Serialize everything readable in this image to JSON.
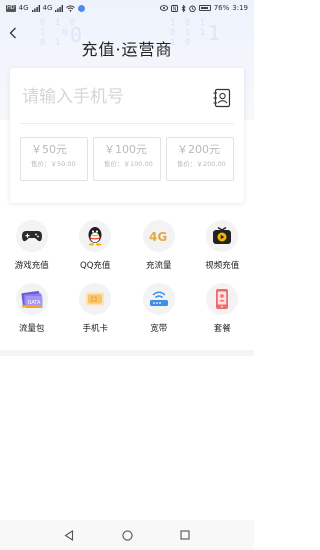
{
  "status_bar": {
    "left_chip": "HD",
    "network_1": "4G",
    "network_2": "4G",
    "battery_text": "76%",
    "time": "3:19"
  },
  "header": {
    "title": "充值·运营商",
    "back_icon": "chevron-left-icon"
  },
  "phone_input": {
    "placeholder": "请输入手机号",
    "value": "",
    "contacts_icon": "contacts-book-icon"
  },
  "amounts": [
    {
      "value": "￥50元",
      "price": "售价：￥50.00"
    },
    {
      "value": "￥100元",
      "price": "售价：￥100.00"
    },
    {
      "value": "￥200元",
      "price": "售价：￥200.00"
    }
  ],
  "services": [
    {
      "label": "游戏充值",
      "icon": "gamepad-icon"
    },
    {
      "label": "QQ充值",
      "icon": "qq-penguin-icon"
    },
    {
      "label": "充流量",
      "icon": "4g-icon"
    },
    {
      "label": "视频充值",
      "icon": "video-play-icon"
    },
    {
      "label": "流量包",
      "icon": "data-package-icon"
    },
    {
      "label": "手机卡",
      "icon": "sim-card-icon"
    },
    {
      "label": "宽带",
      "icon": "router-icon"
    },
    {
      "label": "套餐",
      "icon": "phone-plan-icon"
    }
  ],
  "colors": {
    "accent_orange": "#f5a623",
    "header_bg": "#eef3fb",
    "placeholder": "#d6d6d6",
    "amount_text": "#b9b9b9"
  }
}
